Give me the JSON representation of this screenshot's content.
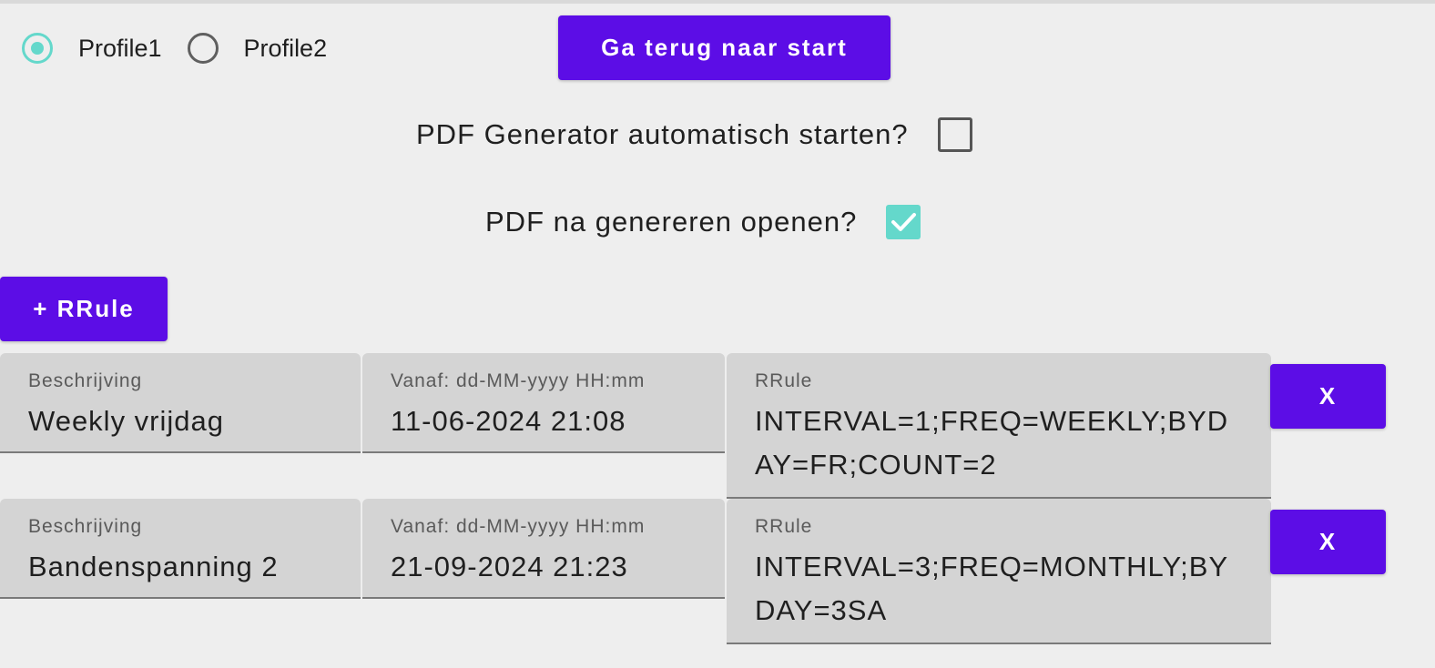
{
  "profiles": {
    "options": [
      {
        "label": "Profile1",
        "selected": true
      },
      {
        "label": "Profile2",
        "selected": false
      }
    ]
  },
  "header": {
    "home_button": "Ga terug naar start"
  },
  "settings": {
    "auto_start": {
      "label": "PDF Generator automatisch starten?",
      "checked": false
    },
    "open_after": {
      "label": "PDF na genereren openen?",
      "checked": true
    }
  },
  "rules": {
    "add_button": "+ RRule",
    "items": [
      {
        "description_label": "Beschrijving",
        "description": "Weekly vrijdag",
        "from_label": "Vanaf: dd-MM-yyyy HH:mm",
        "from": "11-06-2024 21:08",
        "rrule_label": "RRule",
        "rrule": "INTERVAL=1;FREQ=WEEKLY;BYDAY=FR;COUNT=2",
        "delete_label": "X"
      },
      {
        "description_label": "Beschrijving",
        "description": "Bandenspanning 2",
        "from_label": "Vanaf: dd-MM-yyyy HH:mm",
        "from": "21-09-2024 21:23",
        "rrule_label": "RRule",
        "rrule": "INTERVAL=3;FREQ=MONTHLY;BYDAY=3SA",
        "delete_label": "X"
      }
    ]
  },
  "colors": {
    "accent": "#5c0de6",
    "teal": "#64d8cb",
    "background": "#eeeeee",
    "field_bg": "#d4d4d4"
  }
}
